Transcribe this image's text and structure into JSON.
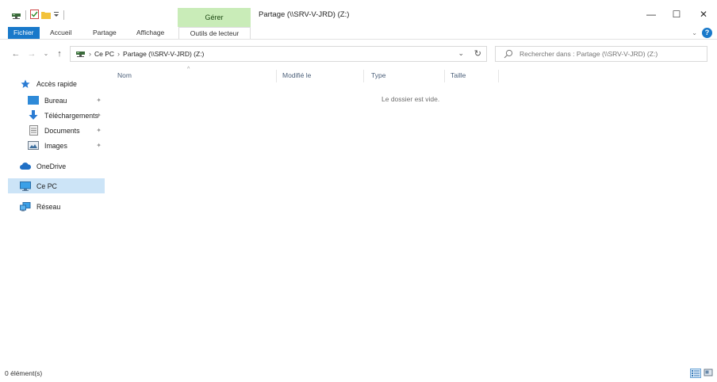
{
  "window": {
    "title": "Partage (\\\\SRV-V-JRD) (Z:)",
    "contextual_tab_group": "Gérer",
    "controls": {
      "minimize": "—",
      "maximize": "☐",
      "close": "✕"
    }
  },
  "ribbon": {
    "tabs": [
      "Fichier",
      "Accueil",
      "Partage",
      "Affichage",
      "Outils de lecteur"
    ],
    "expand_glyph": "⌄",
    "help_glyph": "?"
  },
  "navigation": {
    "back": "←",
    "forward": "→",
    "recent": "⌄",
    "up": "↑",
    "breadcrumb": [
      "Ce PC",
      "Partage (\\\\SRV-V-JRD) (Z:)"
    ],
    "breadcrumb_separator": "›",
    "dropdown_glyph": "⌄",
    "refresh_glyph": "↻"
  },
  "search": {
    "placeholder": "Rechercher dans : Partage (\\\\SRV-V-JRD) (Z:)"
  },
  "nav_pane": {
    "quick_access": "Accès rapide",
    "quick_items": [
      {
        "label": "Bureau",
        "icon": "desktop-folder-icon"
      },
      {
        "label": "Téléchargements",
        "icon": "download-arrow-icon"
      },
      {
        "label": "Documents",
        "icon": "document-icon"
      },
      {
        "label": "Images",
        "icon": "images-folder-icon"
      }
    ],
    "pin_glyph": "✦",
    "onedrive": "OneDrive",
    "this_pc": "Ce PC",
    "network": "Réseau",
    "colors": {
      "selected_bg": "#cce4f7",
      "accent": "#1979ca",
      "gerer_bg": "#c9ecb8"
    }
  },
  "content": {
    "columns": [
      "Nom",
      "Modifié le",
      "Type",
      "Taille"
    ],
    "sort_glyph": "^",
    "empty_message": "Le dossier est vide."
  },
  "status": {
    "item_count": "0 élément(s)"
  }
}
